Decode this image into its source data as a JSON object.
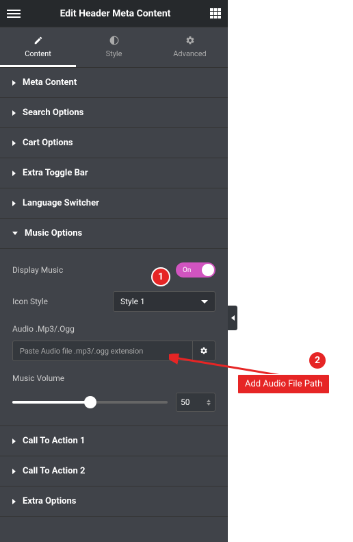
{
  "header": {
    "title": "Edit Header Meta Content"
  },
  "tabs": [
    {
      "label": "Content",
      "active": true
    },
    {
      "label": "Style",
      "active": false
    },
    {
      "label": "Advanced",
      "active": false
    }
  ],
  "sections": {
    "meta_content": {
      "title": "Meta Content"
    },
    "search_options": {
      "title": "Search Options"
    },
    "cart_options": {
      "title": "Cart Options"
    },
    "extra_toggle_bar": {
      "title": "Extra Toggle Bar"
    },
    "language_switcher": {
      "title": "Language Switcher"
    },
    "music_options": {
      "title": "Music Options",
      "display_music": {
        "label": "Display Music",
        "toggle_text": "On"
      },
      "icon_style": {
        "label": "Icon Style",
        "value": "Style 1"
      },
      "audio": {
        "label": "Audio .Mp3/.Ogg",
        "placeholder": "Paste Audio file .mp3/.ogg extension"
      },
      "volume": {
        "label": "Music Volume",
        "value": "50"
      }
    },
    "cta1": {
      "title": "Call To Action 1"
    },
    "cta2": {
      "title": "Call To Action 2"
    },
    "extra_options": {
      "title": "Extra Options"
    }
  },
  "annotations": {
    "badge1": "1",
    "badge2": "2",
    "label": "Add Audio File Path"
  }
}
